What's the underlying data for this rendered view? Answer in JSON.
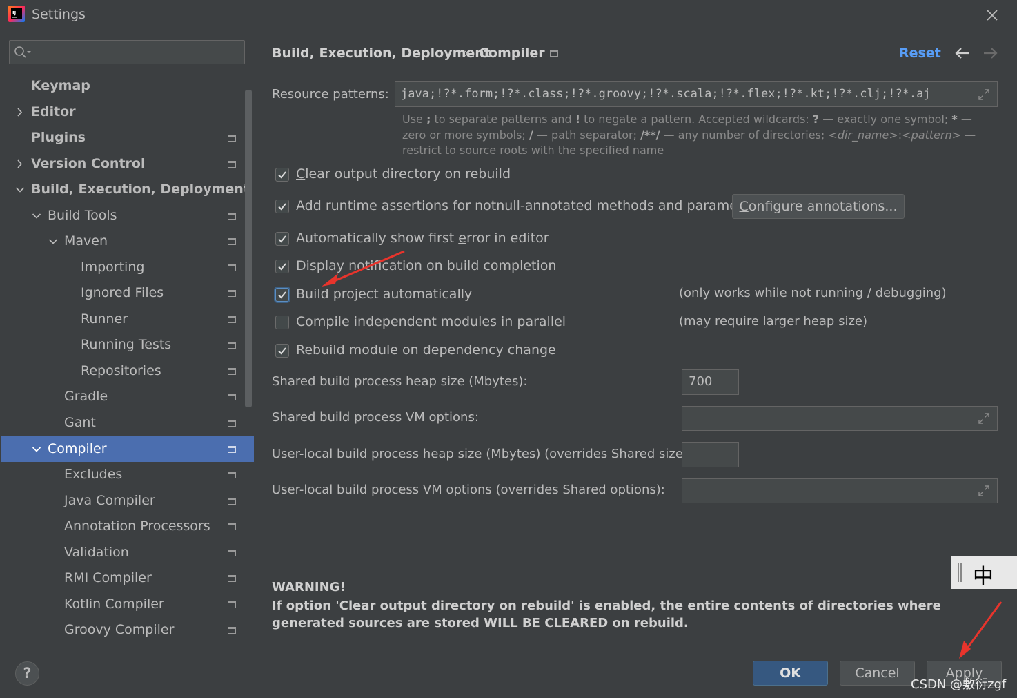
{
  "window": {
    "title": "Settings"
  },
  "search": {
    "placeholder": ""
  },
  "sidebar": {
    "items": [
      {
        "label": "Keymap"
      },
      {
        "label": "Editor"
      },
      {
        "label": "Plugins"
      },
      {
        "label": "Version Control"
      },
      {
        "label": "Build, Execution, Deployment"
      },
      {
        "label": "Build Tools"
      },
      {
        "label": "Maven"
      },
      {
        "label": "Importing"
      },
      {
        "label": "Ignored Files"
      },
      {
        "label": "Runner"
      },
      {
        "label": "Running Tests"
      },
      {
        "label": "Repositories"
      },
      {
        "label": "Gradle"
      },
      {
        "label": "Gant"
      },
      {
        "label": "Compiler"
      },
      {
        "label": "Excludes"
      },
      {
        "label": "Java Compiler"
      },
      {
        "label": "Annotation Processors"
      },
      {
        "label": "Validation"
      },
      {
        "label": "RMI Compiler"
      },
      {
        "label": "Kotlin Compiler"
      },
      {
        "label": "Groovy Compiler"
      }
    ]
  },
  "header": {
    "breadcrumb_parent": "Build, Execution, Deployment",
    "breadcrumb_sep": "›",
    "breadcrumb_current": "Compiler",
    "reset_label": "Reset"
  },
  "resource_patterns": {
    "label": "Resource patterns:",
    "value": "java;!?*.form;!?*.class;!?*.groovy;!?*.scala;!?*.flex;!?*.kt;!?*.clj;!?*.aj",
    "hint_1": "Use ",
    "hint_sym_semicolon": ";",
    "hint_2": " to separate patterns and ",
    "hint_sym_bang": "!",
    "hint_3": " to negate a pattern. Accepted wildcards: ",
    "hint_sym_q": "?",
    "hint_4": " — exactly one symbol; ",
    "hint_sym_star": "*",
    "hint_5": " — zero or more symbols; ",
    "hint_sym_slash": "/",
    "hint_6": " — path separator; ",
    "hint_sym_dstar": "/**/",
    "hint_7": " — any number of directories; ",
    "hint_dir_name": "<dir_name>",
    "hint_colon": ":",
    "hint_pattern": "<pattern>",
    "hint_8": " — restrict to source roots with the specified name"
  },
  "options": [
    {
      "label_pre": "",
      "label_u": "C",
      "label_post": "lear output directory on rebuild",
      "checked": true
    },
    {
      "label_pre": "Add runtime ",
      "label_u": "a",
      "label_post": "ssertions for notnull-annotated methods and parameters",
      "checked": true
    },
    {
      "label_pre": "Automatically show first ",
      "label_u": "e",
      "label_post": "rror in editor",
      "checked": true
    },
    {
      "label_pre": "Display notification on build completion",
      "label_u": "",
      "label_post": "",
      "checked": true
    },
    {
      "label_pre": "Build project automatically",
      "label_u": "",
      "label_post": "",
      "checked": true
    },
    {
      "label_pre": "Compile independent modules in parallel",
      "label_u": "",
      "label_post": "",
      "checked": false
    },
    {
      "label_pre": "Rebuild module on dependency change",
      "label_u": "",
      "label_post": "",
      "checked": true
    }
  ],
  "notes": {
    "build_auto": "(only works while not running / debugging)",
    "parallel": "(may require larger heap size)"
  },
  "configure_button": {
    "label_u": "C",
    "label_post": "onfigure annotations..."
  },
  "heap": {
    "label": "Shared build process heap size (Mbytes):",
    "value": "700"
  },
  "vm_options": {
    "label": "Shared build process VM options:",
    "value": ""
  },
  "user_heap": {
    "label": "User-local build process heap size (Mbytes) (overrides Shared size):",
    "value": ""
  },
  "user_vm": {
    "label": "User-local build process VM options (overrides Shared options):",
    "value": ""
  },
  "warning": {
    "title": "WARNING!",
    "text": "If option 'Clear output directory on rebuild' is enabled, the entire contents of directories where generated sources are stored WILL BE CLEARED on rebuild."
  },
  "ime": {
    "char": "中"
  },
  "footer": {
    "help": "?",
    "ok": "OK",
    "cancel": "Cancel",
    "apply": "Apply"
  },
  "watermark": "CSDN @敷衍zgf",
  "colors": {
    "background": "#3c3f41",
    "selection": "#4b6eaf",
    "link": "#589df6",
    "ok_button": "#365880",
    "annotation_arrow": "#e8342c"
  }
}
